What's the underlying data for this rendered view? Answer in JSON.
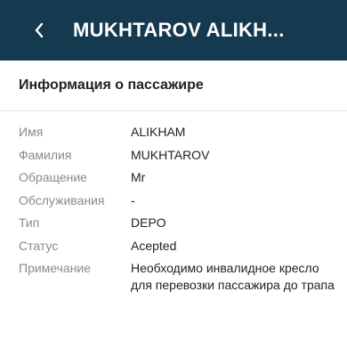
{
  "header": {
    "title": "MUKHTAROV ALIKH...",
    "back_icon": "chevron-left-icon"
  },
  "section": {
    "title": "Информация о пассажире"
  },
  "fields": [
    {
      "label": "Имя",
      "value": "ALIKHAM"
    },
    {
      "label": "Фамилия",
      "value": "MUKHTAROV"
    },
    {
      "label": "Обращение",
      "value": "Mr"
    },
    {
      "label": "Обслуживания",
      "value": "-"
    },
    {
      "label": "Тип",
      "value": "DEPO"
    },
    {
      "label": "Статус",
      "value": "Acepted"
    },
    {
      "label": "Примечание",
      "value": "Необходимо инвалидное кресло для перевозки пассажира до трапа"
    }
  ],
  "colors": {
    "appbar": "#153a4f",
    "label": "#8a8a8a",
    "value": "#222222"
  }
}
